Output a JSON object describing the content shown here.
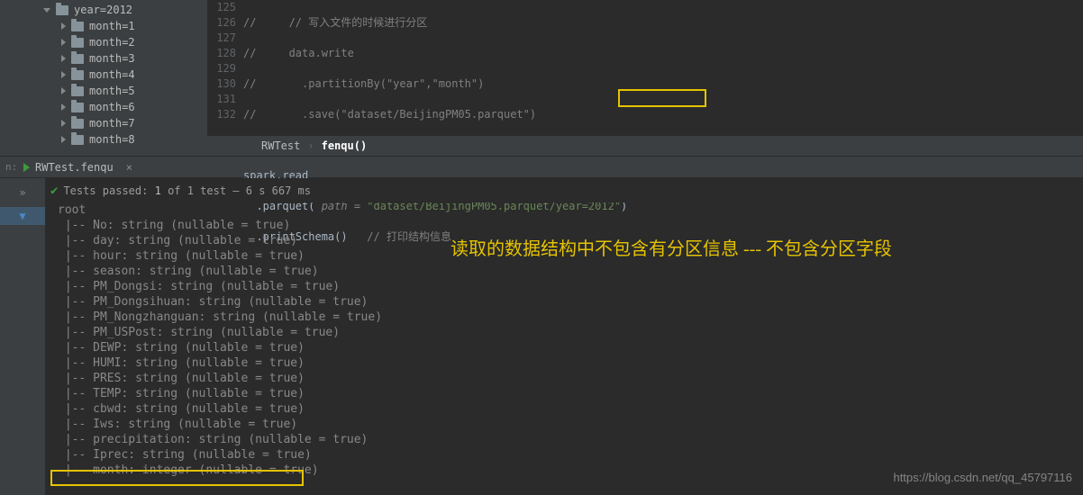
{
  "tree": {
    "yearLabel": "year=2012",
    "months": [
      "month=1",
      "month=2",
      "month=3",
      "month=4",
      "month=5",
      "month=6",
      "month=7",
      "month=8"
    ]
  },
  "editor": {
    "startLine": 125,
    "lines": {
      "l125_comment": "//     // 写入文件的时候进行分区",
      "l126_comment": "//     data.write",
      "l127_comment": "//       .partitionBy(\"year\",\"month\")",
      "l128_comment": "//       .save(\"dataset/BeijingPM05.parquet\")",
      "l130_code": "spark.read",
      "l131_prefix": "  .parquet(",
      "l131_param": " path = ",
      "l131_str_a": "\"dataset/BeijingPM05.parquet/",
      "l131_str_b": "year=2012\"",
      "l131_suffix": ")",
      "l132_code": "  .printSchema()",
      "l132_comment": "   // 打印结构信息"
    }
  },
  "breadcrumb": {
    "a": "RWTest",
    "b": "fenqu()"
  },
  "tab": {
    "label": "RWTest.fenqu"
  },
  "nLabel": "n:",
  "tests": {
    "prefix": "Tests passed:",
    "passed": "1",
    "rest": "of 1 test – 6 s 667 ms"
  },
  "schema": [
    "root",
    " |-- No: string (nullable = true)",
    " |-- day: string (nullable = true)",
    " |-- hour: string (nullable = true)",
    " |-- season: string (nullable = true)",
    " |-- PM_Dongsi: string (nullable = true)",
    " |-- PM_Dongsihuan: string (nullable = true)",
    " |-- PM_Nongzhanguan: string (nullable = true)",
    " |-- PM_USPost: string (nullable = true)",
    " |-- DEWP: string (nullable = true)",
    " |-- HUMI: string (nullable = true)",
    " |-- PRES: string (nullable = true)",
    " |-- TEMP: string (nullable = true)",
    " |-- cbwd: string (nullable = true)",
    " |-- Iws: string (nullable = true)",
    " |-- precipitation: string (nullable = true)",
    " |-- Iprec: string (nullable = true)",
    " |-- month: integer (nullable = true)"
  ],
  "annotation": "读取的数据结构中不包含有分区信息 --- 不包含分区字段",
  "watermark": "https://blog.csdn.net/qq_45797116"
}
